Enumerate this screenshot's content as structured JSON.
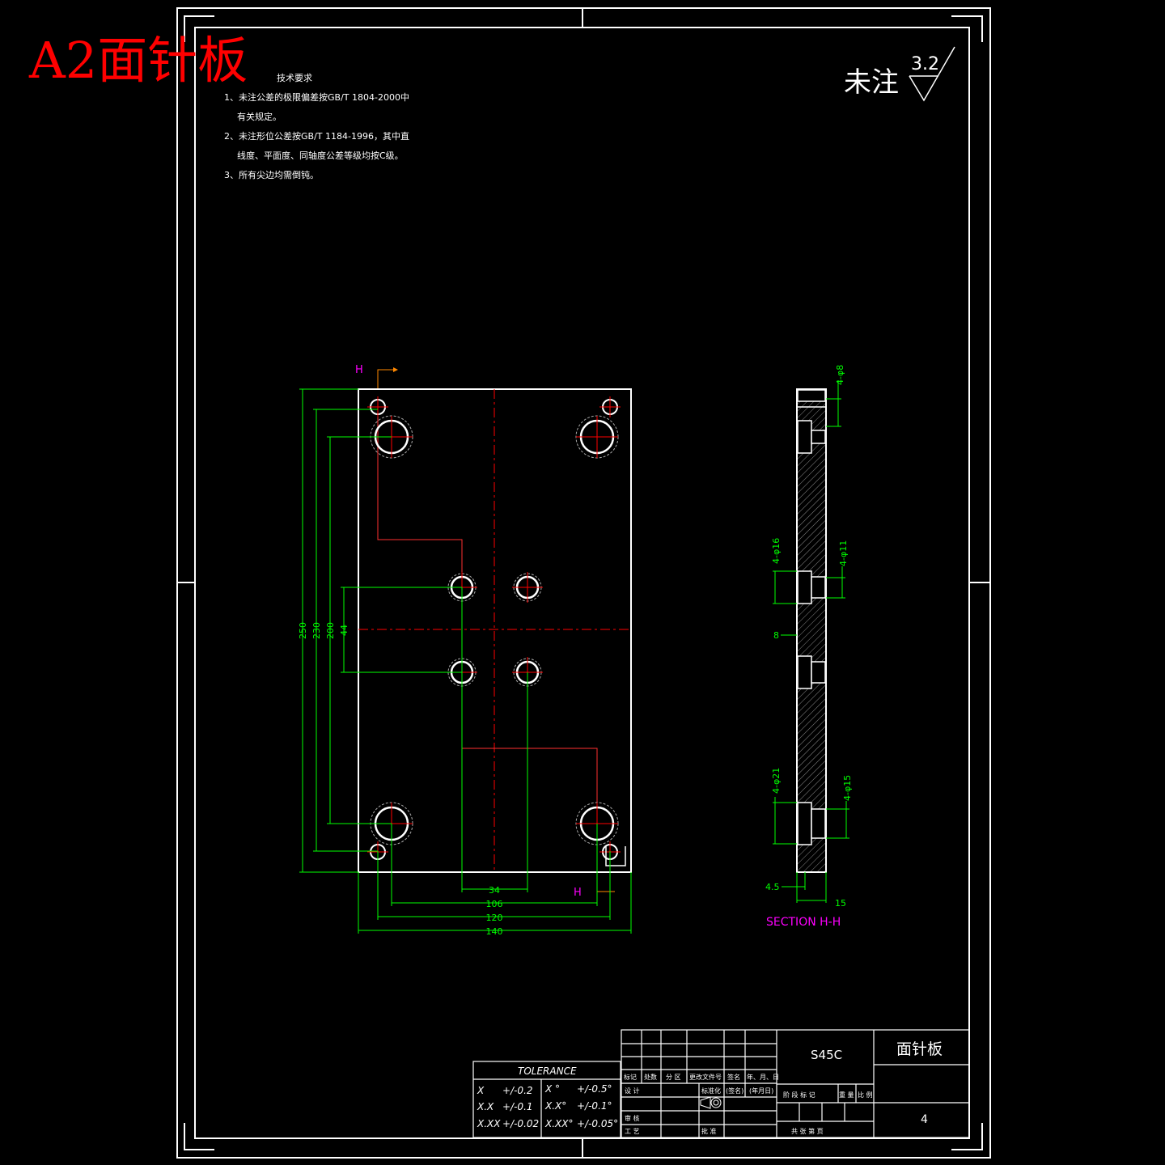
{
  "colors": {
    "background": "#000000",
    "outline": "#ffffff",
    "dimension": "#00ff00",
    "centerline": "#ff0000",
    "section": "#ff00ff",
    "watermark": "#ff0000",
    "orange": "#ff8800"
  },
  "watermark": "A2面针板",
  "tech_req": {
    "title": "技术要求",
    "lines": [
      "1、未注公差的极限偏差按GB/T 1804-2000中",
      "有关规定。",
      "2、未注形位公差按GB/T 1184-1996，其中直",
      "线度、平面度、同轴度公差等级均按C级。",
      "3、所有尖边均需倒钝。"
    ]
  },
  "roughness": {
    "label": "未注",
    "value": "3.2"
  },
  "view_labels": {
    "cut_top": "H",
    "cut_bottom": "H",
    "section": "SECTION  H-H"
  },
  "dims_vertical": [
    "250",
    "230",
    "200",
    "44"
  ],
  "dims_horizontal": [
    "34",
    "106",
    "120",
    "140"
  ],
  "section_dims": [
    "4-φ8",
    "4-φ16",
    "4-φ11",
    "8",
    "4-φ21",
    "4-φ15",
    "4.5",
    "15"
  ],
  "tolerance": {
    "title": "TOLERANCE",
    "rows": [
      [
        "X",
        "+/-0.2",
        "X °",
        "+/-0.5°"
      ],
      [
        "X.X",
        "+/-0.1",
        "X.X°",
        "+/-0.1°"
      ],
      [
        "X.XX",
        "+/-0.02",
        "X.XX°",
        "+/-0.05°"
      ]
    ]
  },
  "title_block": {
    "material": "S45C",
    "part_name": "面针板",
    "sheet": "4",
    "row_labels": [
      "标记",
      "处数",
      "分 区",
      "更改文件号",
      "签名",
      "年、月、日"
    ],
    "design": "设 计",
    "std": "标准化",
    "sign": "(签名)",
    "date": "(年月日)",
    "review": "审 核",
    "process": "工 艺",
    "approve": "批 准",
    "stage_labels": [
      "阶 段 标 记",
      "重 量",
      "比 例"
    ],
    "sheets_label": "共    张    第    页"
  }
}
